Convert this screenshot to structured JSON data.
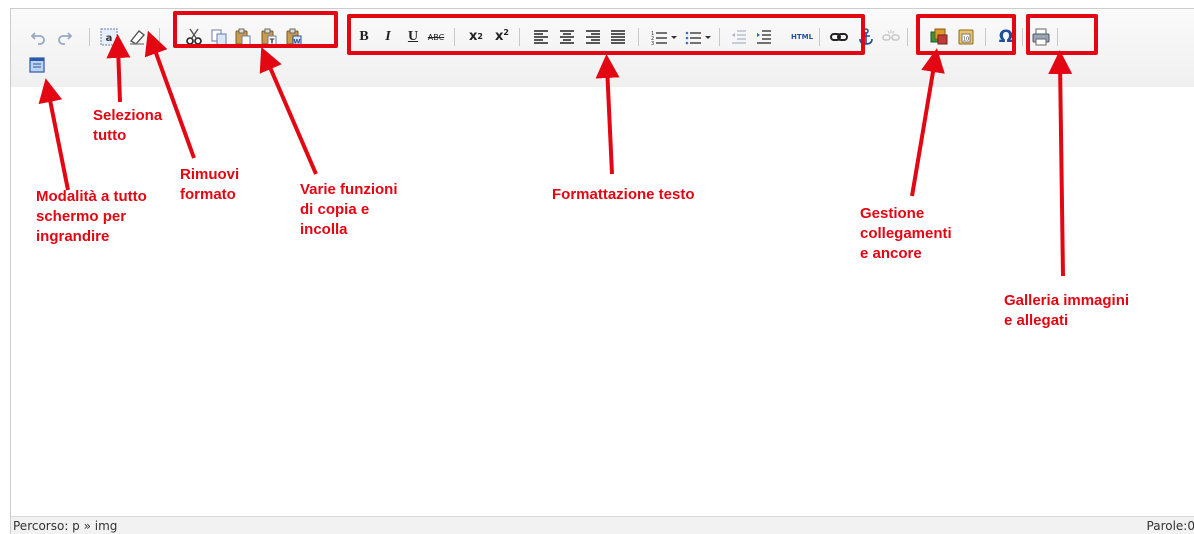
{
  "toolbar": {
    "groups": {
      "history": [
        "undo-icon",
        "redo-icon"
      ],
      "select_clear": [
        "select-all-icon",
        "remove-format-icon"
      ],
      "clipboard": [
        "cut-icon",
        "copy-icon",
        "paste-icon",
        "paste-text-icon",
        "paste-word-icon"
      ],
      "text_format": [
        "bold-icon",
        "italic-icon",
        "underline-icon",
        "strikethrough-icon",
        "subscript-icon",
        "superscript-icon",
        "align-left-icon",
        "align-center-icon",
        "align-right-icon",
        "align-justify-icon",
        "numbered-list-icon",
        "bulleted-list-icon",
        "outdent-icon",
        "indent-icon"
      ],
      "links": [
        "link-icon",
        "anchor-icon",
        "unlink-icon"
      ],
      "media": [
        "image-gallery-icon",
        "attachment-icon"
      ],
      "misc": [
        "special-char-icon",
        "print-icon",
        "fullscreen-icon"
      ]
    },
    "labels": {
      "bold": "B",
      "italic": "I",
      "underline": "U",
      "strikethrough": "ABC",
      "subscript": "x",
      "superscript": "x",
      "html": "HTML",
      "special_char": "Ω"
    }
  },
  "annotations": {
    "fullscreen": "Modalità a tutto\nschermo per\ningrandire",
    "select_all": "Seleziona\ntutto",
    "remove_format": "Rimuovi\nformato",
    "clipboard": "Varie funzioni\ndi copia e\nincolla",
    "text_format": "Formattazione testo",
    "links": "Gestione\ncollegamenti\ne ancore",
    "media": "Galleria immagini\ne allegati"
  },
  "status": {
    "path": "Percorso: p » img",
    "words": "Parole:0"
  },
  "colors": {
    "annotation": "#e30613",
    "toolbar_bg": "#f4f4f4",
    "status_bg": "#f2f2f2"
  }
}
